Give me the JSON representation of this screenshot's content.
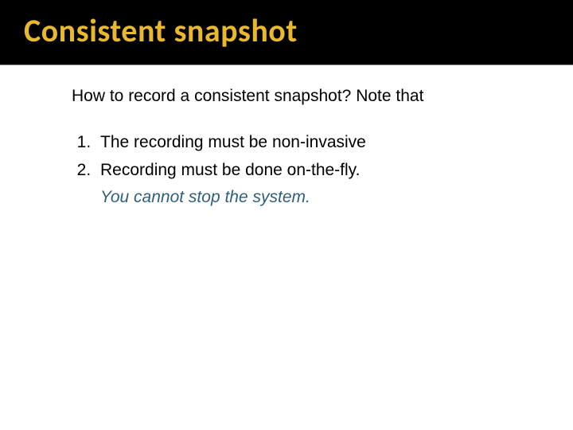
{
  "title": "Consistent snapshot",
  "intro": "How to record a consistent snapshot? Note that",
  "points": {
    "item1_prefix": "The recording must be ",
    "item1_strong": "non-invasive",
    "item2": "Recording must be done on-the-fly."
  },
  "emphasis": "You cannot stop the system."
}
